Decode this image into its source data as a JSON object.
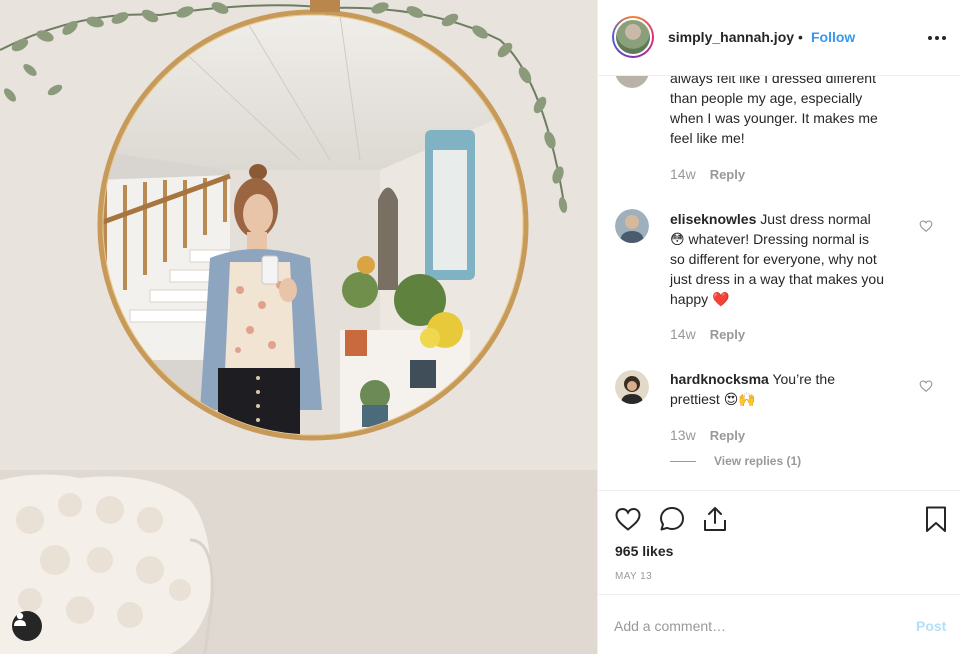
{
  "photo": {
    "description_icon": "person-tag-icon"
  },
  "header": {
    "username": "simply_hannah.joy",
    "separator": "•",
    "follow_label": "Follow",
    "more_icon": "more-options-icon"
  },
  "comments": [
    {
      "text_lines": [
        "always felt like I dressed different",
        "than people my age, especially",
        "when I was younger. It makes me",
        "feel like me!"
      ],
      "time": "14w",
      "reply_label": "Reply"
    },
    {
      "username": "eliseknowles",
      "text_lines": [
        " Just dress normal",
        "😳 whatever! Dressing normal is",
        "so different for everyone, why not",
        "just dress in a way that makes you",
        "happy ❤️"
      ],
      "time": "14w",
      "reply_label": "Reply"
    },
    {
      "username": "hardknocksma",
      "text_lines": [
        " You’re the",
        "prettiest 😍🙌"
      ],
      "time": "13w",
      "reply_label": "Reply",
      "view_replies": "View replies (1)"
    }
  ],
  "actions": {
    "likes": "965 likes",
    "date": "MAY 13"
  },
  "composer": {
    "placeholder": "Add a comment…",
    "post_label": "Post"
  },
  "colors": {
    "link_blue": "#3897f0",
    "post_disabled": "#b2dffc",
    "meta_gray": "#999999",
    "heart_red": "#ed4956"
  }
}
